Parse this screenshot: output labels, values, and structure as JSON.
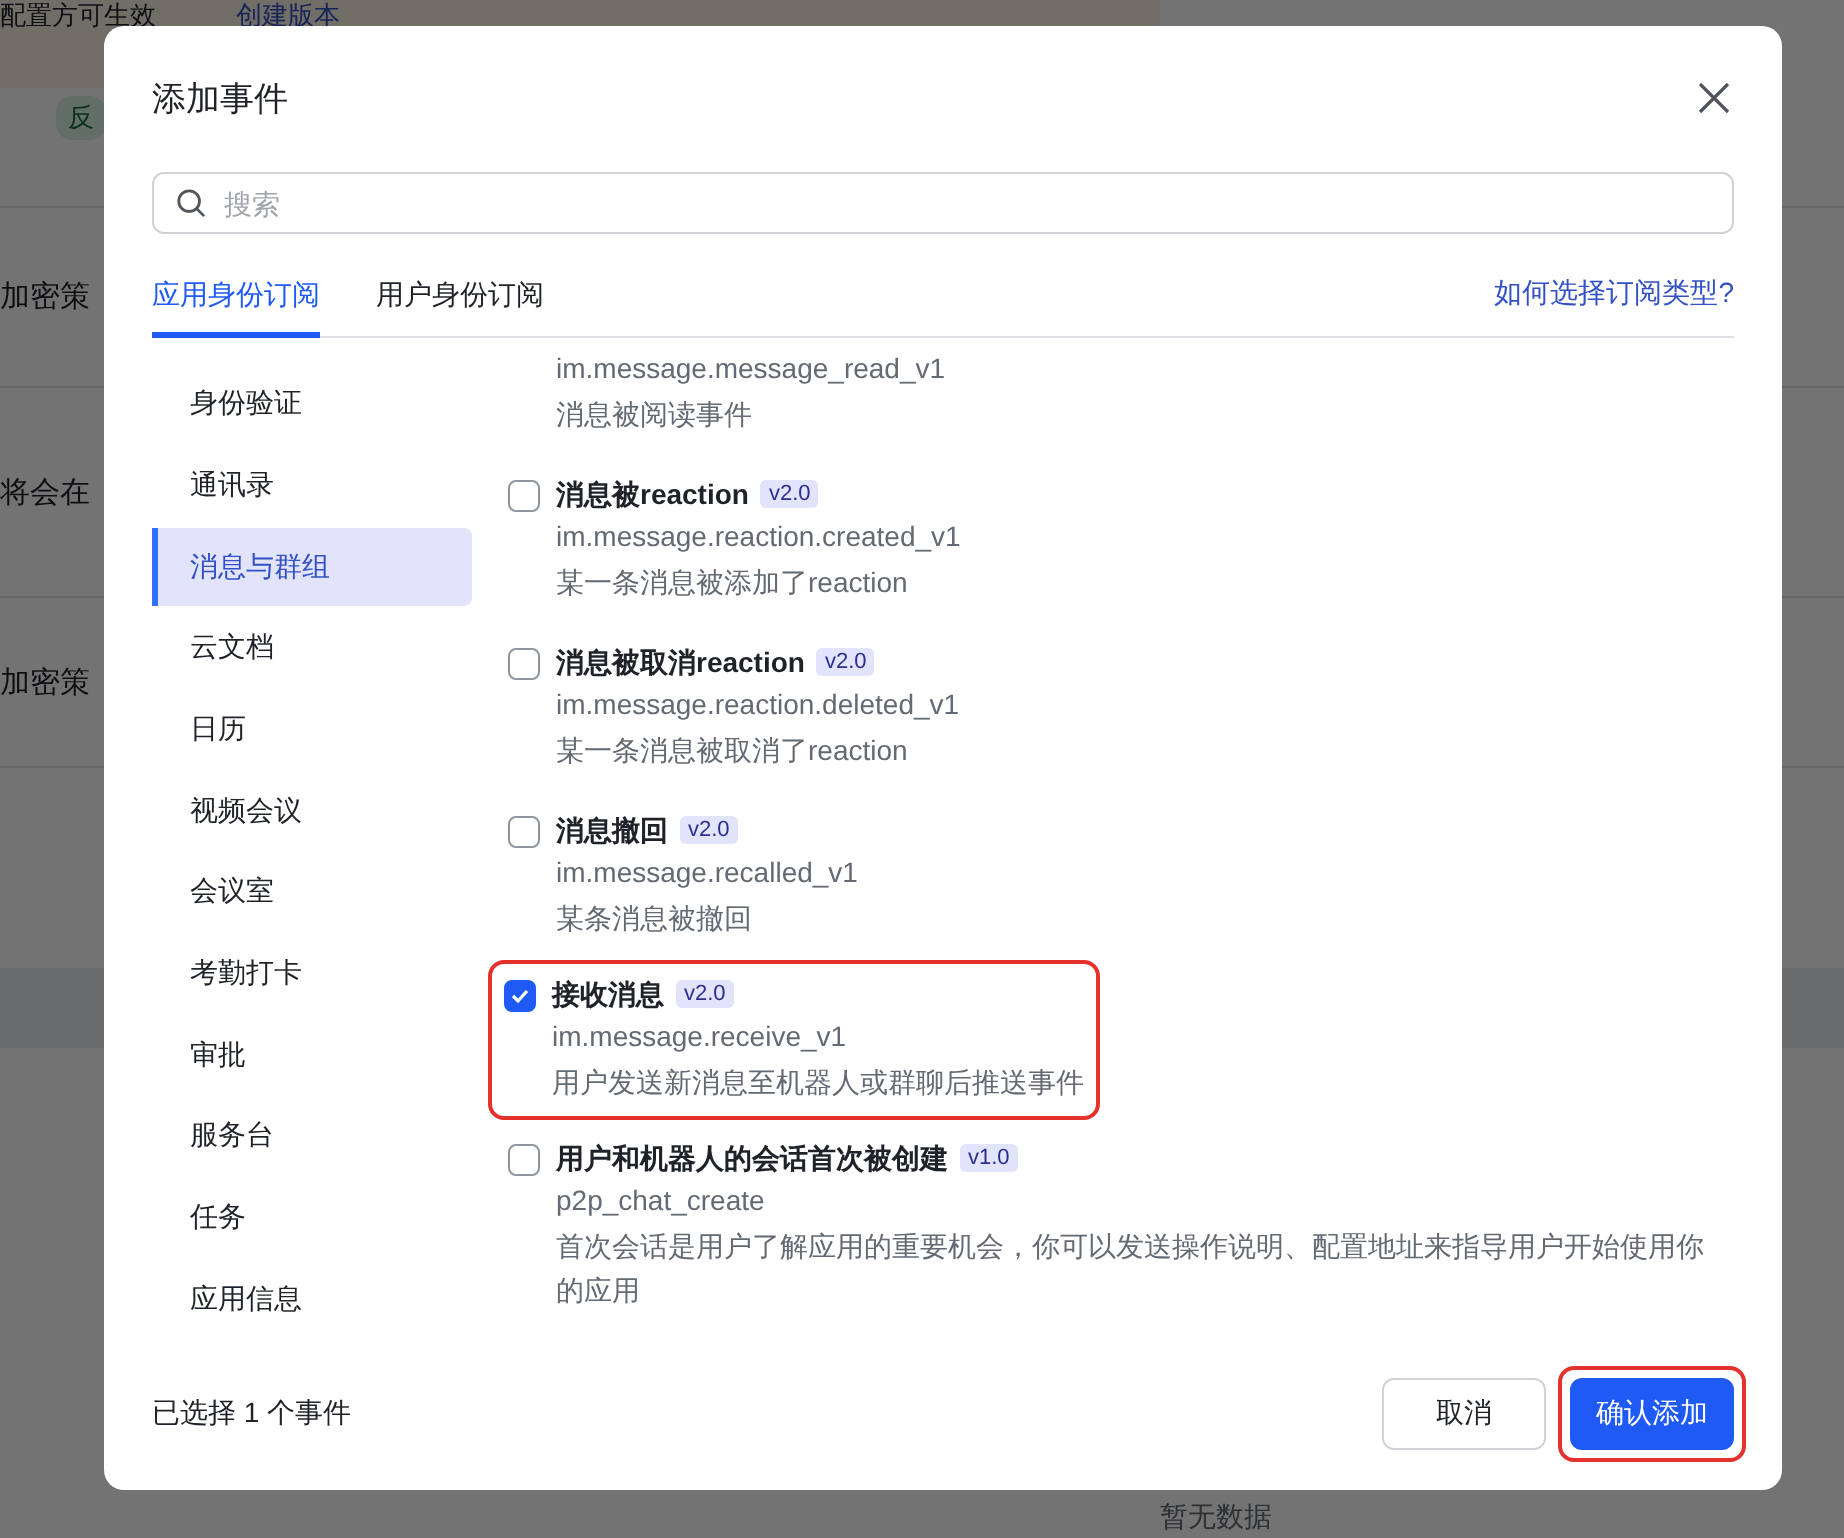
{
  "background": {
    "banner_text": "配置方可生效",
    "banner_link": "创建版本",
    "tag": "反",
    "rows": [
      "加密策",
      "将会在",
      "加密策"
    ],
    "empty_text": "暂无数据"
  },
  "dialog": {
    "title": "添加事件",
    "search": {
      "placeholder": "搜索"
    },
    "tabs": [
      {
        "label": "应用身份订阅",
        "selected": true
      },
      {
        "label": "用户身份订阅",
        "selected": false
      }
    ],
    "help_link": "如何选择订阅类型?",
    "categories": [
      {
        "label": "身份验证",
        "selected": false
      },
      {
        "label": "通讯录",
        "selected": false
      },
      {
        "label": "消息与群组",
        "selected": true
      },
      {
        "label": "云文档",
        "selected": false
      },
      {
        "label": "日历",
        "selected": false
      },
      {
        "label": "视频会议",
        "selected": false
      },
      {
        "label": "会议室",
        "selected": false
      },
      {
        "label": "考勤打卡",
        "selected": false
      },
      {
        "label": "审批",
        "selected": false
      },
      {
        "label": "服务台",
        "selected": false
      },
      {
        "label": "任务",
        "selected": false
      },
      {
        "label": "应用信息",
        "selected": false
      }
    ],
    "events": [
      {
        "kind": "partial",
        "code": "im.message.message_read_v1",
        "description": "消息被阅读事件"
      },
      {
        "kind": "full",
        "name": "消息被reaction",
        "version": "v2.0",
        "code": "im.message.reaction.created_v1",
        "description": "某一条消息被添加了reaction",
        "checked": false,
        "highlighted": false
      },
      {
        "kind": "full",
        "name": "消息被取消reaction",
        "version": "v2.0",
        "code": "im.message.reaction.deleted_v1",
        "description": "某一条消息被取消了reaction",
        "checked": false,
        "highlighted": false
      },
      {
        "kind": "full",
        "name": "消息撤回",
        "version": "v2.0",
        "code": "im.message.recalled_v1",
        "description": "某条消息被撤回",
        "checked": false,
        "highlighted": false
      },
      {
        "kind": "full",
        "name": "接收消息",
        "version": "v2.0",
        "code": "im.message.receive_v1",
        "description": "用户发送新消息至机器人或群聊后推送事件",
        "checked": true,
        "highlighted": true
      },
      {
        "kind": "full",
        "name": "用户和机器人的会话首次被创建",
        "version": "v1.0",
        "code": "p2p_chat_create",
        "description": "首次会话是用户了解应用的重要机会，你可以发送操作说明、配置地址来指导用户开始使用你的应用",
        "checked": false,
        "highlighted": false
      }
    ],
    "selection_text": "已选择 1 个事件",
    "buttons": [
      {
        "label": "取消",
        "kind": "secondary",
        "highlighted": false
      },
      {
        "label": "确认添加",
        "kind": "primary",
        "highlighted": true
      }
    ]
  }
}
